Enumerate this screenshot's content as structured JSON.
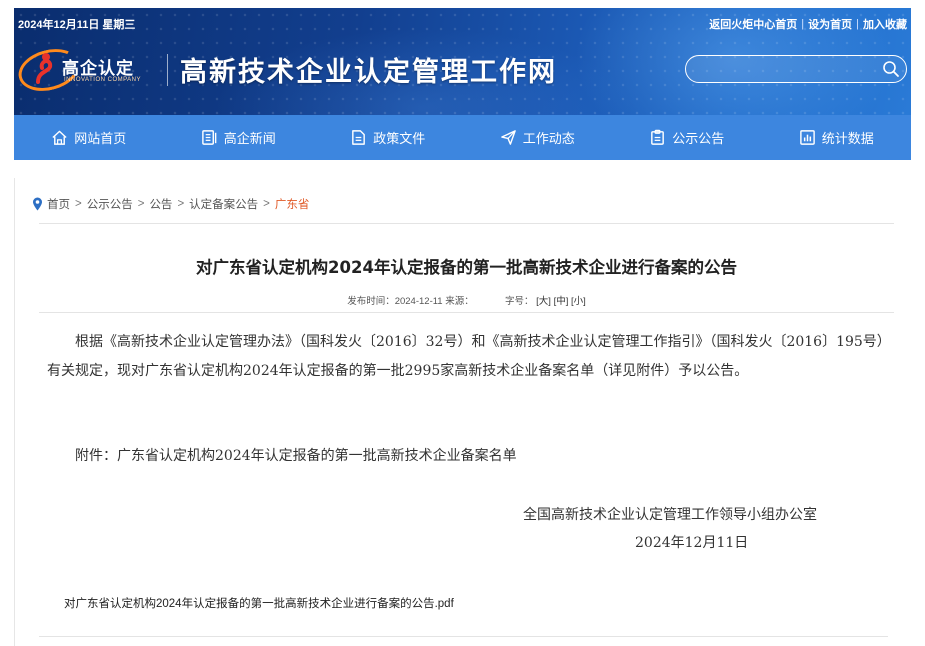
{
  "header": {
    "date": "2024年12月11日  星期三",
    "links": [
      "返回火炬中心首页",
      "设为首页",
      "加入收藏"
    ],
    "link_separator": "|",
    "logo_cn": "高企认定",
    "logo_en": "INNOVATION COMPANY",
    "site_title": "高新技术企业认定管理工作网",
    "search": {
      "placeholder": "",
      "value": ""
    }
  },
  "nav": {
    "items": [
      {
        "label": "网站首页",
        "icon": "home-icon"
      },
      {
        "label": "高企新闻",
        "icon": "news-icon"
      },
      {
        "label": "政策文件",
        "icon": "document-icon"
      },
      {
        "label": "工作动态",
        "icon": "send-icon"
      },
      {
        "label": "公示公告",
        "icon": "clipboard-icon"
      },
      {
        "label": "统计数据",
        "icon": "chart-icon"
      }
    ]
  },
  "breadcrumb": {
    "items": [
      "首页",
      "公示公告",
      "公告",
      "认定备案公告"
    ],
    "current": "广东省",
    "separator": ">"
  },
  "article": {
    "title": "对广东省认定机构2024年认定报备的第一批高新技术企业进行备案的公告",
    "publish_label": "发布时间：2024-12-11 来源：",
    "font_size_label": "字号：",
    "font_sizes": [
      "[大]",
      "[中]",
      "[小]"
    ],
    "body": "根据《高新技术企业认定管理办法》（国科发火〔2016〕32号）和《高新技术企业认定管理工作指引》（国科发火〔2016〕195号）有关规定，现对广东省认定机构2024年认定报备的第一批2995家高新技术企业备案名单（详见附件）予以公告。",
    "attachment_text": "附件：广东省认定机构2024年认定报备的第一批高新技术企业备案名单",
    "signature_org": "全国高新技术企业认定管理工作领导小组办公室",
    "signature_date": "2024年12月11日",
    "file_link": "对广东省认定机构2024年认定报备的第一批高新技术企业进行备案的公告.pdf"
  },
  "colors": {
    "nav_bg": "#3d86df",
    "breadcrumb_current": "#e05a28",
    "logo_accent": "#ff8a1c"
  }
}
